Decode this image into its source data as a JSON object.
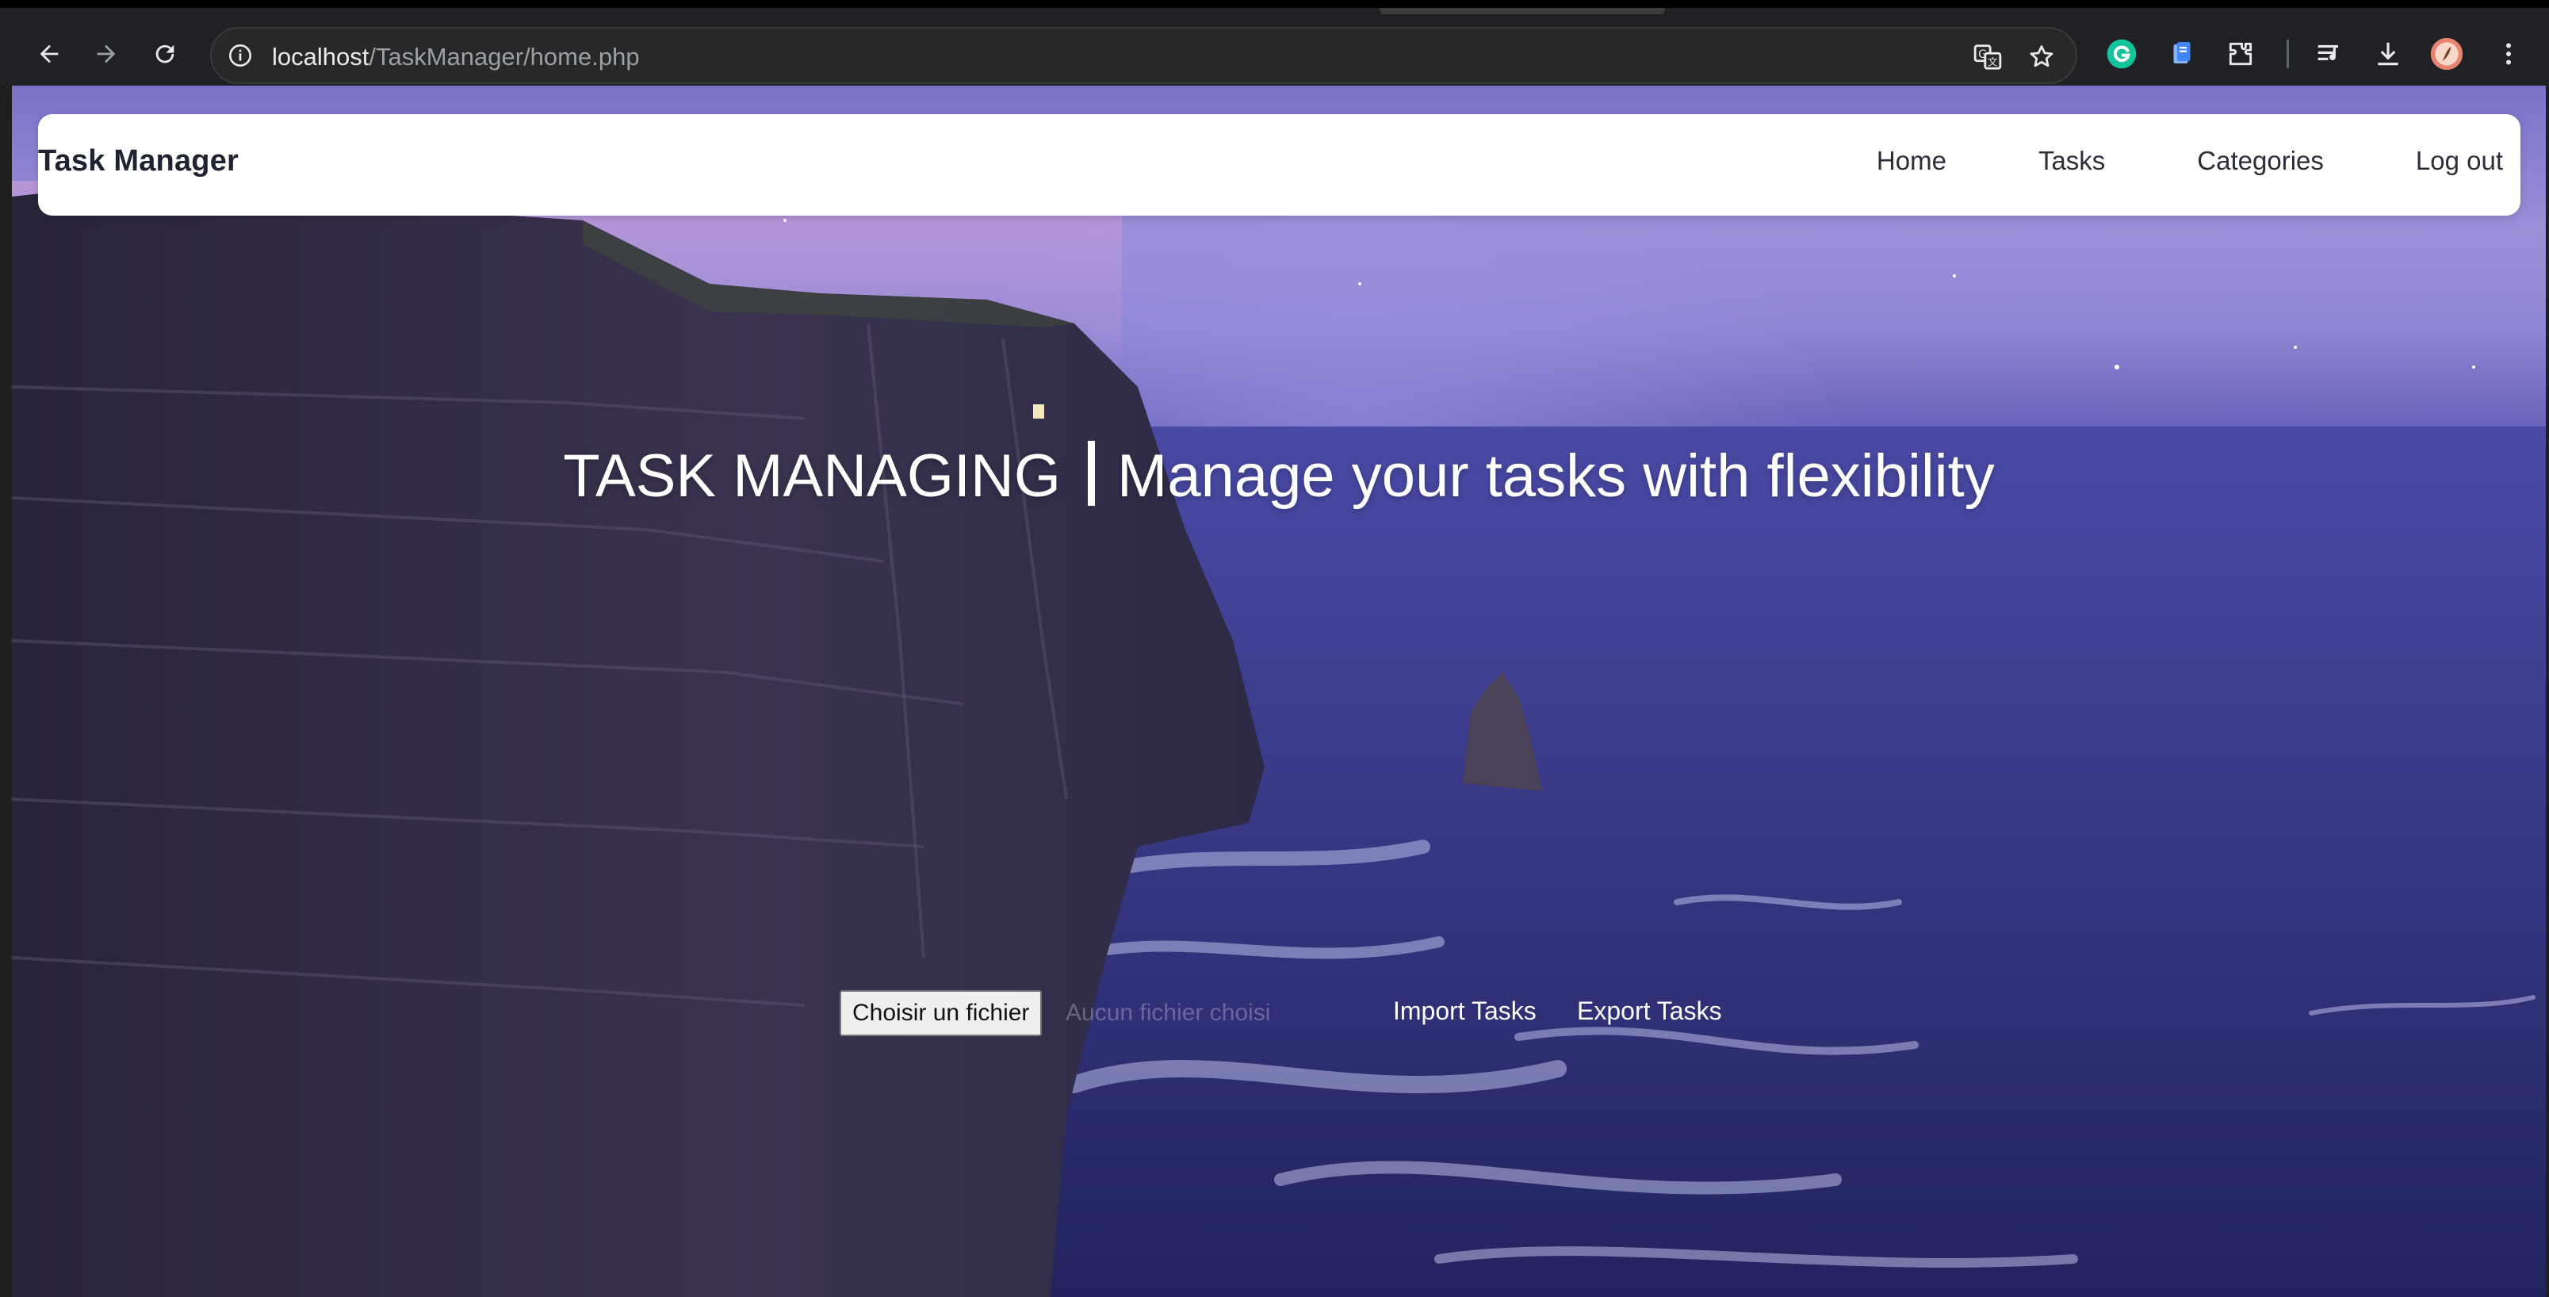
{
  "browser": {
    "url_host": "localhost",
    "url_path": "/TaskManager/home.php",
    "icons": [
      "back-icon",
      "forward-icon",
      "reload-icon",
      "site-info-icon",
      "translate-icon",
      "bookmark-star-icon",
      "grammarly-icon",
      "extension-doc-icon",
      "extensions-puzzle-icon",
      "reading-list-icon",
      "download-icon",
      "profile-avatar",
      "menu-kebab-icon"
    ]
  },
  "navbar": {
    "brand": "Task Manager",
    "links": [
      "Home",
      "Tasks",
      "Categories",
      "Log out"
    ]
  },
  "hero": {
    "title_left": "TASK MANAGING",
    "title_right": "Manage your tasks with flexibility"
  },
  "file_input": {
    "button_label": "Choisir un fichier",
    "status": "Aucun fichier choisi"
  },
  "actions": {
    "import_label": "Import Tasks",
    "export_label": "Export Tasks"
  },
  "colors": {
    "chrome_bg": "#202124",
    "omnibox_bg": "#282828",
    "sky_top": "#9b8fd8",
    "sea": "#2c2d7c",
    "navbar_bg": "#ffffff",
    "grammarly_green": "#15c39a",
    "avatar": "#e8836f"
  }
}
